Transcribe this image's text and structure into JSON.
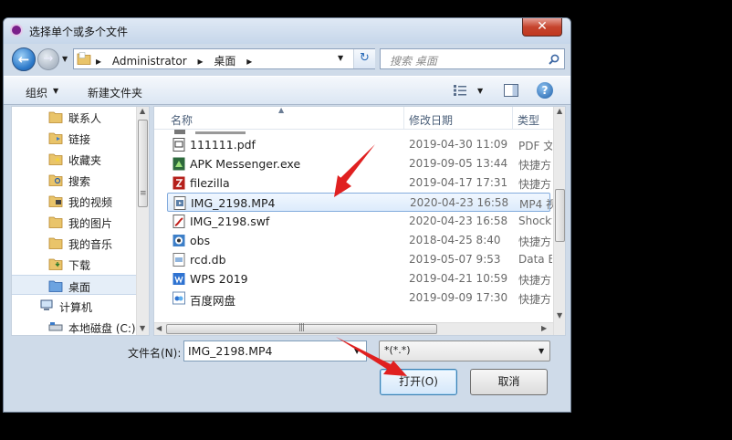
{
  "window": {
    "title": "选择单个或多个文件",
    "close_label": "✕"
  },
  "address": {
    "path": [
      "Administrator",
      "桌面"
    ],
    "separator": "▸"
  },
  "search": {
    "placeholder": "搜索 桌面"
  },
  "toolbar": {
    "organize_label": "组织",
    "new_folder_label": "新建文件夹"
  },
  "nav": {
    "items": [
      {
        "label": "联系人",
        "icon": "contacts-folder-icon"
      },
      {
        "label": "链接",
        "icon": "links-folder-icon"
      },
      {
        "label": "收藏夹",
        "icon": "favorites-folder-icon"
      },
      {
        "label": "搜索",
        "icon": "search-folder-icon"
      },
      {
        "label": "我的视频",
        "icon": "videos-folder-icon"
      },
      {
        "label": "我的图片",
        "icon": "pictures-folder-icon"
      },
      {
        "label": "我的音乐",
        "icon": "music-folder-icon"
      },
      {
        "label": "下载",
        "icon": "downloads-folder-icon"
      },
      {
        "label": "桌面",
        "icon": "desktop-folder-icon"
      },
      {
        "label": "计算机",
        "icon": "computer-icon"
      },
      {
        "label": "本地磁盘 (C:)",
        "icon": "drive-icon"
      }
    ]
  },
  "columns": {
    "name": "名称",
    "modified": "修改日期",
    "type": "类型"
  },
  "files": [
    {
      "name": "111111.pdf",
      "date": "2019-04-30 11:09",
      "type": "PDF 文",
      "icon": "pdf-file-icon"
    },
    {
      "name": "APK Messenger.exe",
      "date": "2019-09-05 13:44",
      "type": "快捷方",
      "icon": "exe-file-icon"
    },
    {
      "name": "filezilla",
      "date": "2019-04-17 17:31",
      "type": "快捷方",
      "icon": "filezilla-shortcut-icon"
    },
    {
      "name": "IMG_2198.MP4",
      "date": "2020-04-23 16:58",
      "type": "MP4 视",
      "icon": "video-file-icon"
    },
    {
      "name": "IMG_2198.swf",
      "date": "2020-04-23 16:58",
      "type": "Shockv",
      "icon": "swf-file-icon"
    },
    {
      "name": "obs",
      "date": "2018-04-25 8:40",
      "type": "快捷方",
      "icon": "obs-shortcut-icon"
    },
    {
      "name": "rcd.db",
      "date": "2019-05-07 9:53",
      "type": "Data B",
      "icon": "db-file-icon"
    },
    {
      "name": "WPS 2019",
      "date": "2019-04-21 10:59",
      "type": "快捷方",
      "icon": "wps-shortcut-icon"
    },
    {
      "name": "百度网盘",
      "date": "2019-09-09 17:30",
      "type": "快捷方",
      "icon": "baidu-shortcut-icon"
    }
  ],
  "filename": {
    "label": "文件名(N):",
    "value": "IMG_2198.MP4"
  },
  "filetype": {
    "value": "*(*.*)"
  },
  "buttons": {
    "open": "打开(O)",
    "cancel": "取消"
  },
  "colors": {
    "accent": "#3c7fb1",
    "annotation_arrow": "#e02020",
    "selection": "#dcebfc"
  }
}
